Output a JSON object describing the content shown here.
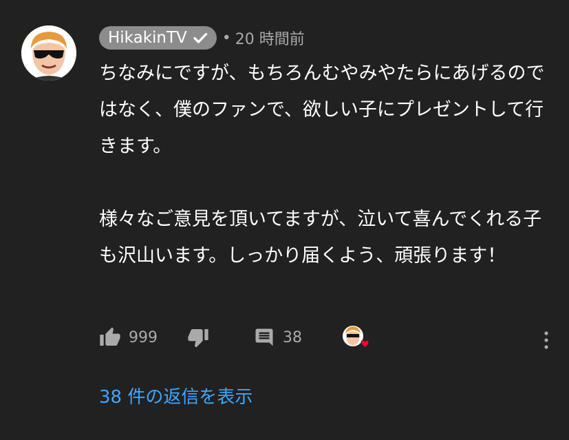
{
  "comment": {
    "channel_name": "HikakinTV",
    "time_ago": "20 時間前",
    "meta_separator": "•",
    "paragraph1": "ちなみにですが、もちろんむやみやたらにあげるのではなく、僕のファンで、欲しい子にプレゼントして行きます。",
    "paragraph2": "様々なご意見を頂いてますが、泣いて喜んでくれる子も沢山います。しっかり届くよう、頑張ります！"
  },
  "actions": {
    "like_count": "999",
    "reply_count": "38"
  },
  "replies": {
    "label": "38 件の返信を表示"
  },
  "colors": {
    "background": "#212121",
    "channel_pill": "#8c8c8c",
    "link": "#3ea6ff",
    "heart": "#ff0033"
  },
  "icons": [
    "avatar",
    "verified-check-icon",
    "thumb-up-icon",
    "thumb-down-icon",
    "comment-icon",
    "creator-heart-icon",
    "more-vert-icon"
  ]
}
